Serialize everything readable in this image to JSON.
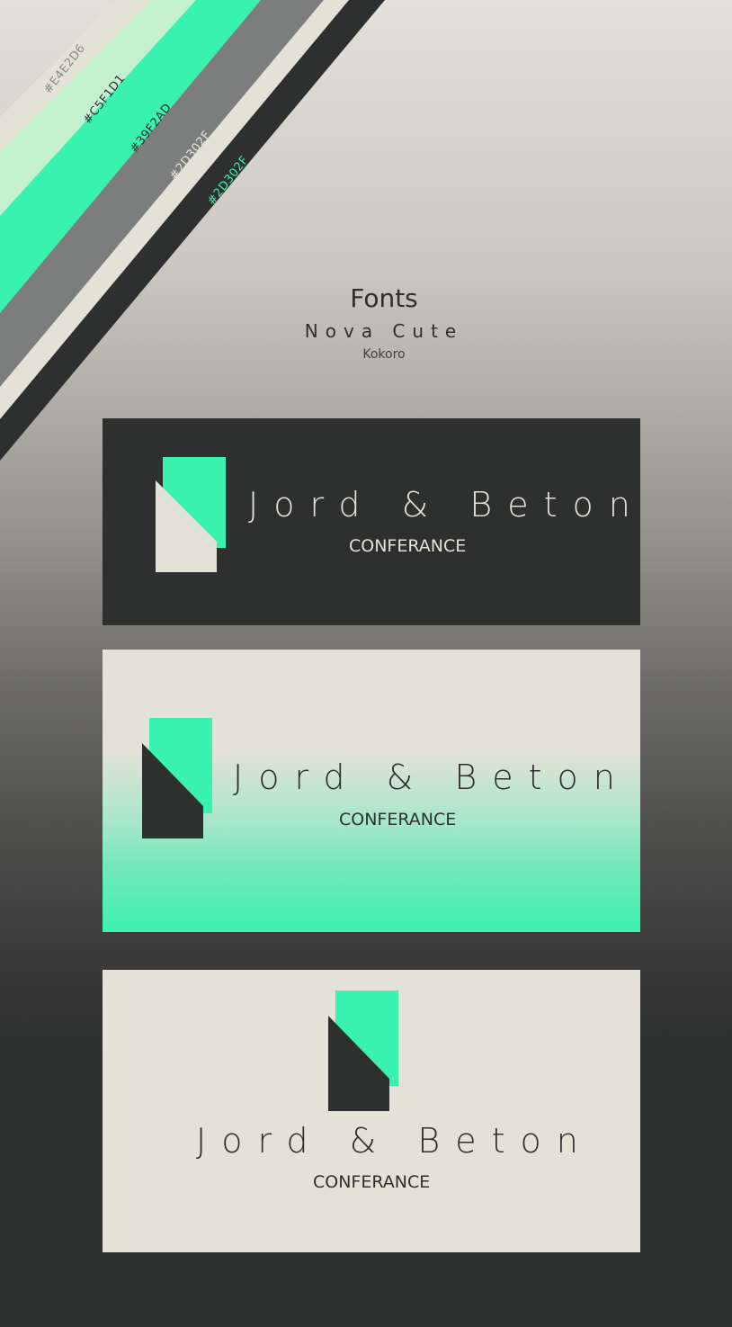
{
  "palette": {
    "swatches": [
      {
        "label": "#E4E2D6",
        "color": "#E4E2D6",
        "label_color": "#8a8983"
      },
      {
        "label": "#C5F1D1",
        "color": "#C5F1D1",
        "label_color": "#2d302f"
      },
      {
        "label": "#39F2AD",
        "color": "#39F2AD",
        "label_color": "#2d302f"
      },
      {
        "label": "#2D302F",
        "color": "#7b7e7d",
        "label_color": "#e4e2d6"
      },
      {
        "label": "#2D302F",
        "color": "#2D302F",
        "label_color": "#39F2AD"
      }
    ]
  },
  "fonts": {
    "title": "Fonts",
    "primary": "Nova Cute",
    "secondary": "Kokoro"
  },
  "cards": [
    {
      "wordmark": "Jord & Beton",
      "tagline": "CONFERANCE"
    },
    {
      "wordmark": "Jord & Beton",
      "tagline": "CONFERANCE"
    },
    {
      "wordmark": "Jord & Beton",
      "tagline": "CONFERANCE"
    }
  ],
  "colors": {
    "accent": "#39F2AD",
    "light": "#E4E2D6",
    "dark": "#2D302F"
  }
}
